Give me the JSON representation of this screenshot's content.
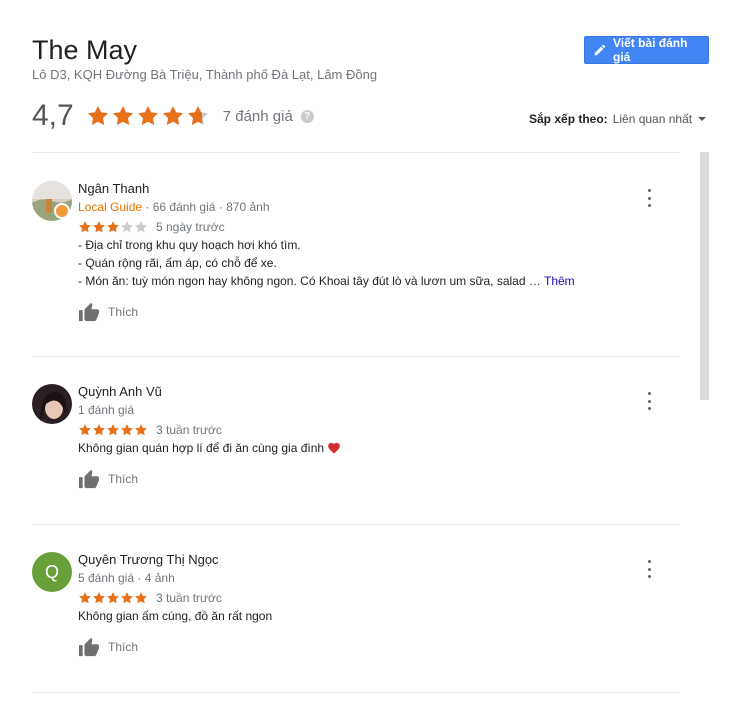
{
  "place": {
    "name": "The May",
    "address": "Lô D3, KQH Đường Bà Triệu, Thành phố Đà Lạt, Lâm Đồng"
  },
  "write_review_label": "Viết bài đánh giá",
  "summary": {
    "rating": "4,7",
    "stars": 4.7,
    "count_label": "7 đánh giá"
  },
  "sort": {
    "label": "Sắp xếp theo:",
    "value": "Liên quan nhất"
  },
  "colors": {
    "star": "#e7711b",
    "star_empty": "#cccccc",
    "accent": "#4285f4",
    "more_link": "#1a0dab",
    "local_guide": "#e37400"
  },
  "like_label": "Thích",
  "reviews": [
    {
      "name": "Ngân Thanh",
      "local_guide": "Local Guide",
      "meta": "· 66 đánh giá · 870 ảnh",
      "stars": 3,
      "time": "5 ngày trước",
      "text": "- Địa chỉ trong khu quy hoạch hơi khó tìm.\n- Quán rộng rãi, ấm áp, có chỗ để xe.\n- Món ăn: tuỳ món ngon hay không ngon. Có Khoai tây đút lò và lươn um sữa, salad … ",
      "more": "Thêm"
    },
    {
      "name": "Quỳnh Anh Vũ",
      "meta": "1 đánh giá",
      "stars": 5,
      "time": "3 tuần trước",
      "text": "Không gian quán hợp lí để đi ăn cùng gia đình ",
      "emoji": "❤️"
    },
    {
      "name": "Quyên Trương Thị Ngọc",
      "avatar_letter": "Q",
      "meta": "5 đánh giá · 4 ảnh",
      "stars": 5,
      "time": "3 tuần trước",
      "text": "Không gian ấm cúng, đồ ăn rất ngon"
    }
  ]
}
